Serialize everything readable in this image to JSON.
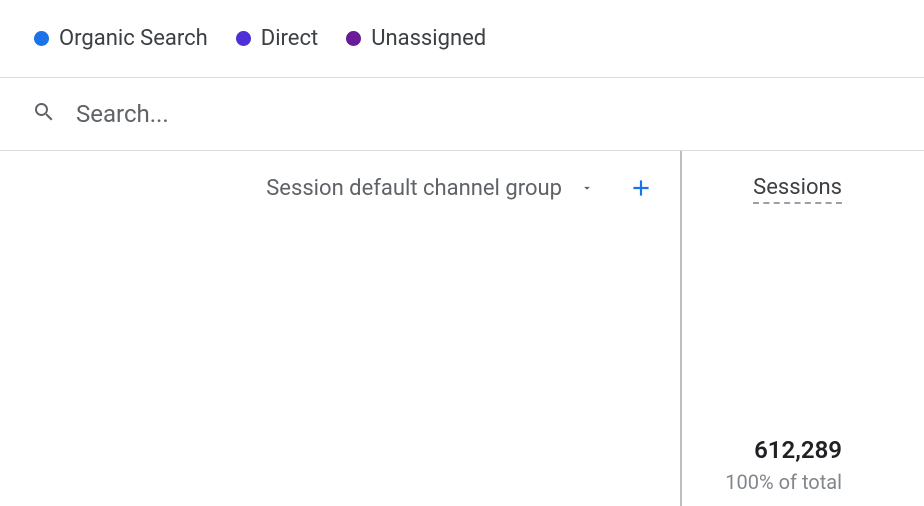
{
  "legend": {
    "items": [
      {
        "label": "Organic Search",
        "color": "#1a73e8"
      },
      {
        "label": "Direct",
        "color": "#4f30d4"
      },
      {
        "label": "Unassigned",
        "color": "#6a1b9a"
      }
    ]
  },
  "search": {
    "placeholder": "Search..."
  },
  "dimension": {
    "label": "Session default channel group"
  },
  "metric": {
    "header": "Sessions",
    "total_value": "612,289",
    "subtext": "100% of total"
  }
}
